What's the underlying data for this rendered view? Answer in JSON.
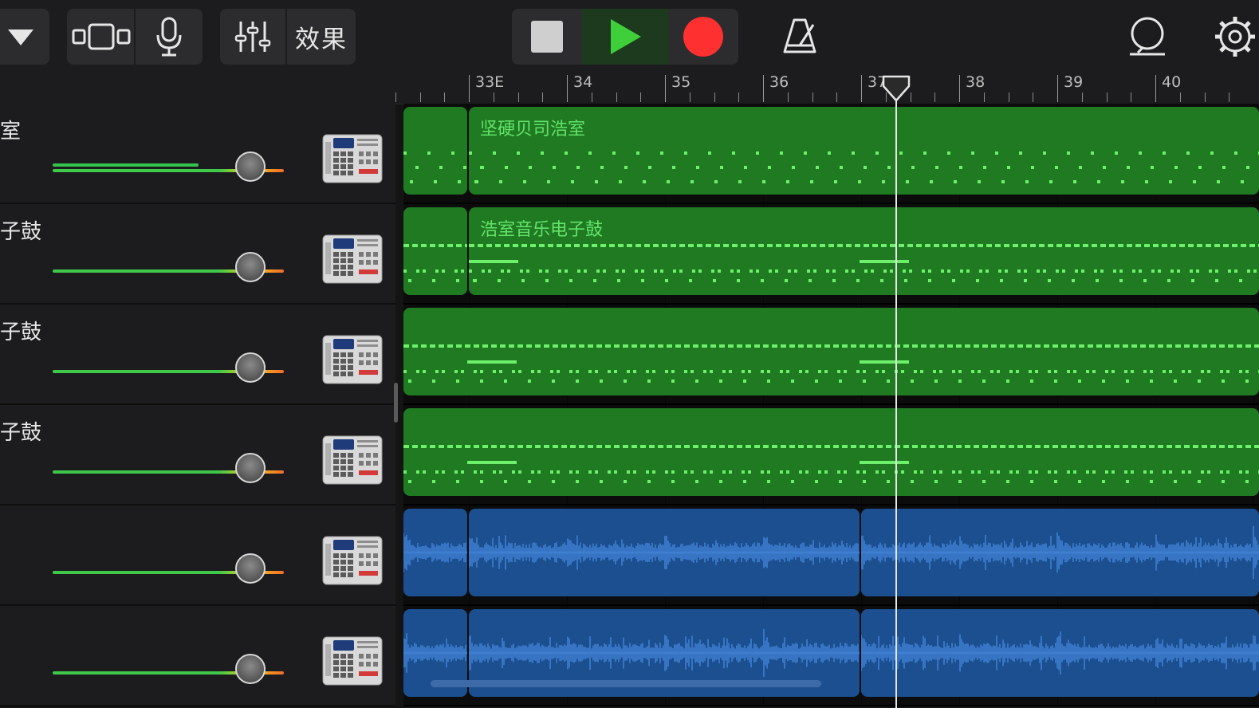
{
  "toolbar": {
    "fx_label": "效果",
    "icons": [
      "dropdown-triangle-icon",
      "view-toggle-icon",
      "microphone-icon",
      "mixer-sliders-icon",
      "stop-icon",
      "play-icon",
      "record-icon",
      "metronome-icon",
      "loop-icon",
      "settings-icon"
    ]
  },
  "ruler": {
    "bars": [
      {
        "label": "33E"
      },
      {
        "label": "34"
      },
      {
        "label": "35"
      },
      {
        "label": "36"
      },
      {
        "label": "37"
      },
      {
        "label": "38"
      },
      {
        "label": "39"
      },
      {
        "label": "40"
      }
    ]
  },
  "tracks": [
    {
      "name": "室",
      "volume": 0.88,
      "meter": 0.63,
      "type": "midi",
      "region_label": "坚硬贝司浩室"
    },
    {
      "name": "子鼓",
      "volume": 0.88,
      "meter": 0.0,
      "type": "midi",
      "region_label": "浩室音乐电子鼓"
    },
    {
      "name": "子鼓",
      "volume": 0.88,
      "meter": 0.0,
      "type": "midi",
      "region_label": ""
    },
    {
      "name": "子鼓",
      "volume": 0.88,
      "meter": 0.0,
      "type": "midi",
      "region_label": ""
    },
    {
      "name": "",
      "volume": 0.88,
      "meter": 0.0,
      "type": "audio",
      "region_label": ""
    },
    {
      "name": "",
      "volume": 0.88,
      "meter": 0.0,
      "type": "audio",
      "region_label": ""
    }
  ],
  "colors": {
    "midi_region": "#1f7a22",
    "midi_note": "#6df06a",
    "audio_region": "#1b4f8f",
    "audio_wave": "#3f7fd1",
    "play": "#3fcf3a",
    "record": "#ff3030"
  }
}
